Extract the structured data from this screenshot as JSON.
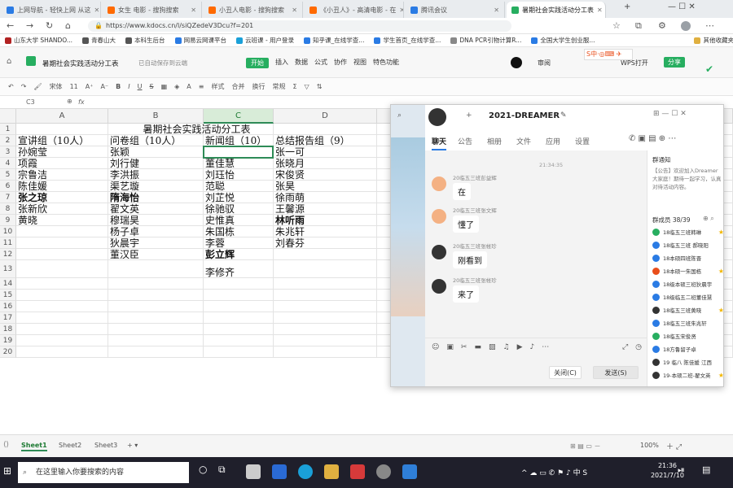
{
  "browser": {
    "tabs": [
      {
        "label": "上网导航 - 轻快上网 从这",
        "color": "#2a7be4"
      },
      {
        "label": "女生 电影 - 搜狗搜索",
        "color": "#ff6a00"
      },
      {
        "label": "小丑人电影 - 搜狗搜索",
        "color": "#ff6a00"
      },
      {
        "label": "《小丑人》- 高清电影 - 在",
        "color": "#ff6a00"
      },
      {
        "label": "腾讯会议",
        "color": "#2a7be4"
      },
      {
        "label": "暑期社会实践活动分工表",
        "color": "#27ae60"
      }
    ],
    "url": "https://www.kdocs.cn/l/siQZedeV3Dcu?f=201",
    "bookmarks": [
      "山东大学 SHANDO...",
      "青春山大",
      "本科生后台",
      "网易云网课平台",
      "云班课 - 用户登录",
      "知乎课_在线学查...",
      "学生首页_在线学查...",
      "DNA PCR引物计算R...",
      "全国大学生创业服...",
      "其他收藏夹"
    ]
  },
  "wps": {
    "doc_title": "暑期社会实践活动分工表",
    "save_state": "已自动保存到云端",
    "menus": [
      "开始",
      "插入",
      "数据",
      "公式",
      "协作",
      "视图",
      "特色功能"
    ],
    "right_buttons": [
      "审阅",
      "WPS打开",
      "分享"
    ],
    "toolbar": [
      "宋体",
      "11",
      "A⁺",
      "A⁻",
      "B",
      "I",
      "U",
      "S",
      "样式",
      "合并",
      "换行",
      "常规"
    ],
    "cell_ref": "C3",
    "fx": "fx"
  },
  "sheet": {
    "columns": [
      "A",
      "B",
      "C",
      "D"
    ],
    "rows": [
      "1",
      "2",
      "3",
      "4",
      "5",
      "6",
      "7",
      "8",
      "9",
      "10",
      "11",
      "12",
      "13",
      "14",
      "15",
      "16",
      "17",
      "18",
      "19",
      "20"
    ],
    "title": "暑期社会实践活动分工表",
    "headers": [
      "宣讲组（10人）",
      "问卷组（10人）",
      "新闻组（10）",
      "总结报告组（9）"
    ],
    "col_a": [
      "孙婉莹",
      "项霞",
      "宗鲁洁",
      "陈佳媛",
      "张之琼",
      "张新欣",
      "黄晓"
    ],
    "col_b": [
      "张颖",
      "刘行健",
      "李洪振",
      "渠艺璇",
      "隋海怡",
      "翟文英",
      "穆瑞昊",
      "杨子卓",
      "狄晨宇",
      "董汉臣"
    ],
    "col_c": [
      "",
      "董佳慧",
      "刘珏怡",
      "范聪",
      "刘芷悦",
      "徐驰驭",
      "史惟真",
      "朱国栋",
      "李蓉",
      "彭立辉",
      "李修齐"
    ],
    "col_d": [
      "张一可",
      "张晓月",
      "宋俊贤",
      "张昊",
      "徐雨萌",
      "王馨源",
      "林听雨",
      "朱兆轩",
      "刘春芬"
    ]
  },
  "sheet_tabs": [
    "Sheet1",
    "Sheet2",
    "Sheet3"
  ],
  "zoom": "100%",
  "chat": {
    "group_name": "2021-DREAMER",
    "tabs": [
      "聊天",
      "公告",
      "相册",
      "文件",
      "应用",
      "设置"
    ],
    "time": "21:34:35",
    "messages": [
      {
        "sender": "20临五三班彭益辉",
        "text": "在"
      },
      {
        "sender": "20临五三班张文辉",
        "text": "懂了"
      },
      {
        "sender": "20临五三班张帐珍",
        "text": "刚看到"
      },
      {
        "sender": "20临五三班张帐珍",
        "text": "来了"
      }
    ],
    "close_label": "关闭(C)",
    "send_label": "发送(S)",
    "notice_title": "群通知",
    "notice_text": "【公告】欢迎加入Dreamer大家庭！期待一起学习，认真对待活动内容。",
    "members_title": "群成员 38/39",
    "members": [
      "18临五三班韩琳",
      "18临五三班 郝晓阳",
      "18本硕四班陈晋",
      "18本硕一朱国栋",
      "18级本硕三班狄晨宇",
      "18级临五二班董佳慧",
      "18临五三班黄晓",
      "18临五三班朱兆轩",
      "18临五宋俊贤",
      "18方鲁留子卓",
      "19 临八 陈佳媛 江西",
      "19-本硕二班-翟文英"
    ]
  },
  "taskbar": {
    "search_placeholder": "在这里输入你要搜索的内容",
    "time": "21:36",
    "date": "2021/7/10"
  }
}
